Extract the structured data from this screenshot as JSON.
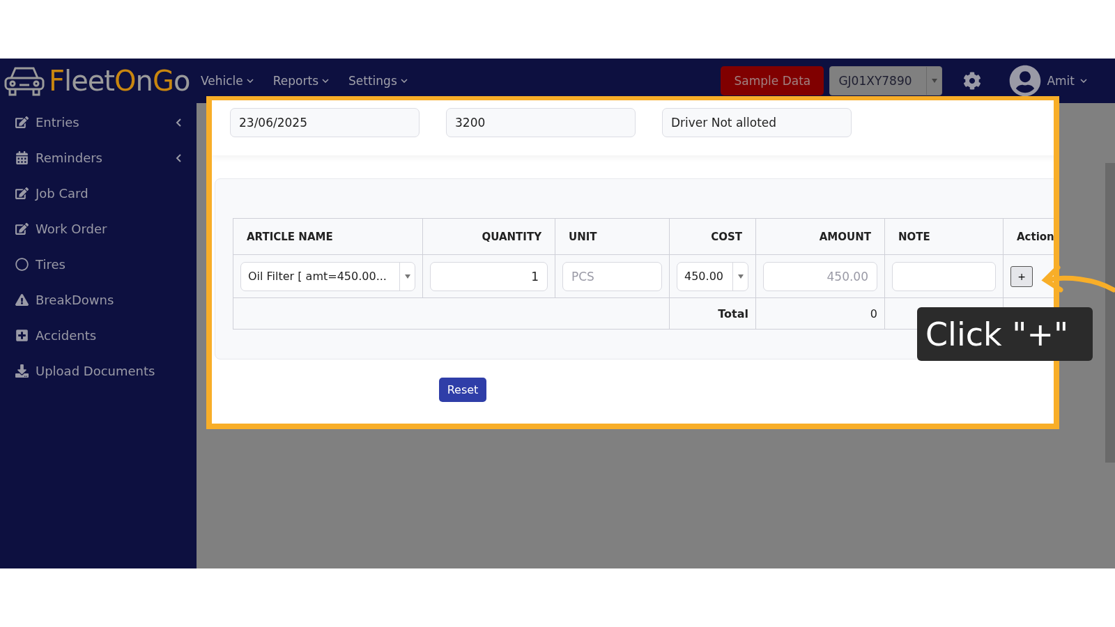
{
  "header": {
    "logo": [
      {
        "text": "F",
        "accent": true
      },
      {
        "text": "leet",
        "accent": false
      },
      {
        "text": "O",
        "accent": true
      },
      {
        "text": "n",
        "accent": false
      },
      {
        "text": "G",
        "accent": true
      },
      {
        "text": "o",
        "accent": false
      }
    ],
    "nav": [
      "Vehicle",
      "Reports",
      "Settings"
    ],
    "sample_button": "Sample Data",
    "vehicle_select": "GJ01XY7890",
    "user": "Amit"
  },
  "sidebar": {
    "items": [
      {
        "label": "Entries",
        "kind": "edit",
        "expandable": true
      },
      {
        "label": "Reminders",
        "kind": "calendar",
        "expandable": true
      },
      {
        "label": "Job Card",
        "kind": "edit",
        "expandable": false
      },
      {
        "label": "Work Order",
        "kind": "edit",
        "expandable": false
      },
      {
        "label": "Tires",
        "kind": "circle",
        "expandable": false
      },
      {
        "label": "BreakDowns",
        "kind": "warning",
        "expandable": false
      },
      {
        "label": "Accidents",
        "kind": "plus",
        "expandable": false
      },
      {
        "label": "Upload Documents",
        "kind": "download",
        "expandable": false
      }
    ]
  },
  "fields": [
    "23/06/2025",
    "3200",
    "Driver Not alloted"
  ],
  "table": {
    "columns": [
      "ARTICLE NAME",
      "QUANTITY",
      "UNIT",
      "COST",
      "AMOUNT",
      "NOTE",
      "Action"
    ],
    "row": {
      "article": "Oil Filter [ amt=450.00...",
      "quantity": "1",
      "unit_placeholder": "PCS",
      "cost": "450.00",
      "amount": "450.00",
      "action": "+"
    },
    "total_label": "Total",
    "total_value": "0"
  },
  "reset_button": "Reset",
  "callout": {
    "text": "Click \"+\""
  }
}
